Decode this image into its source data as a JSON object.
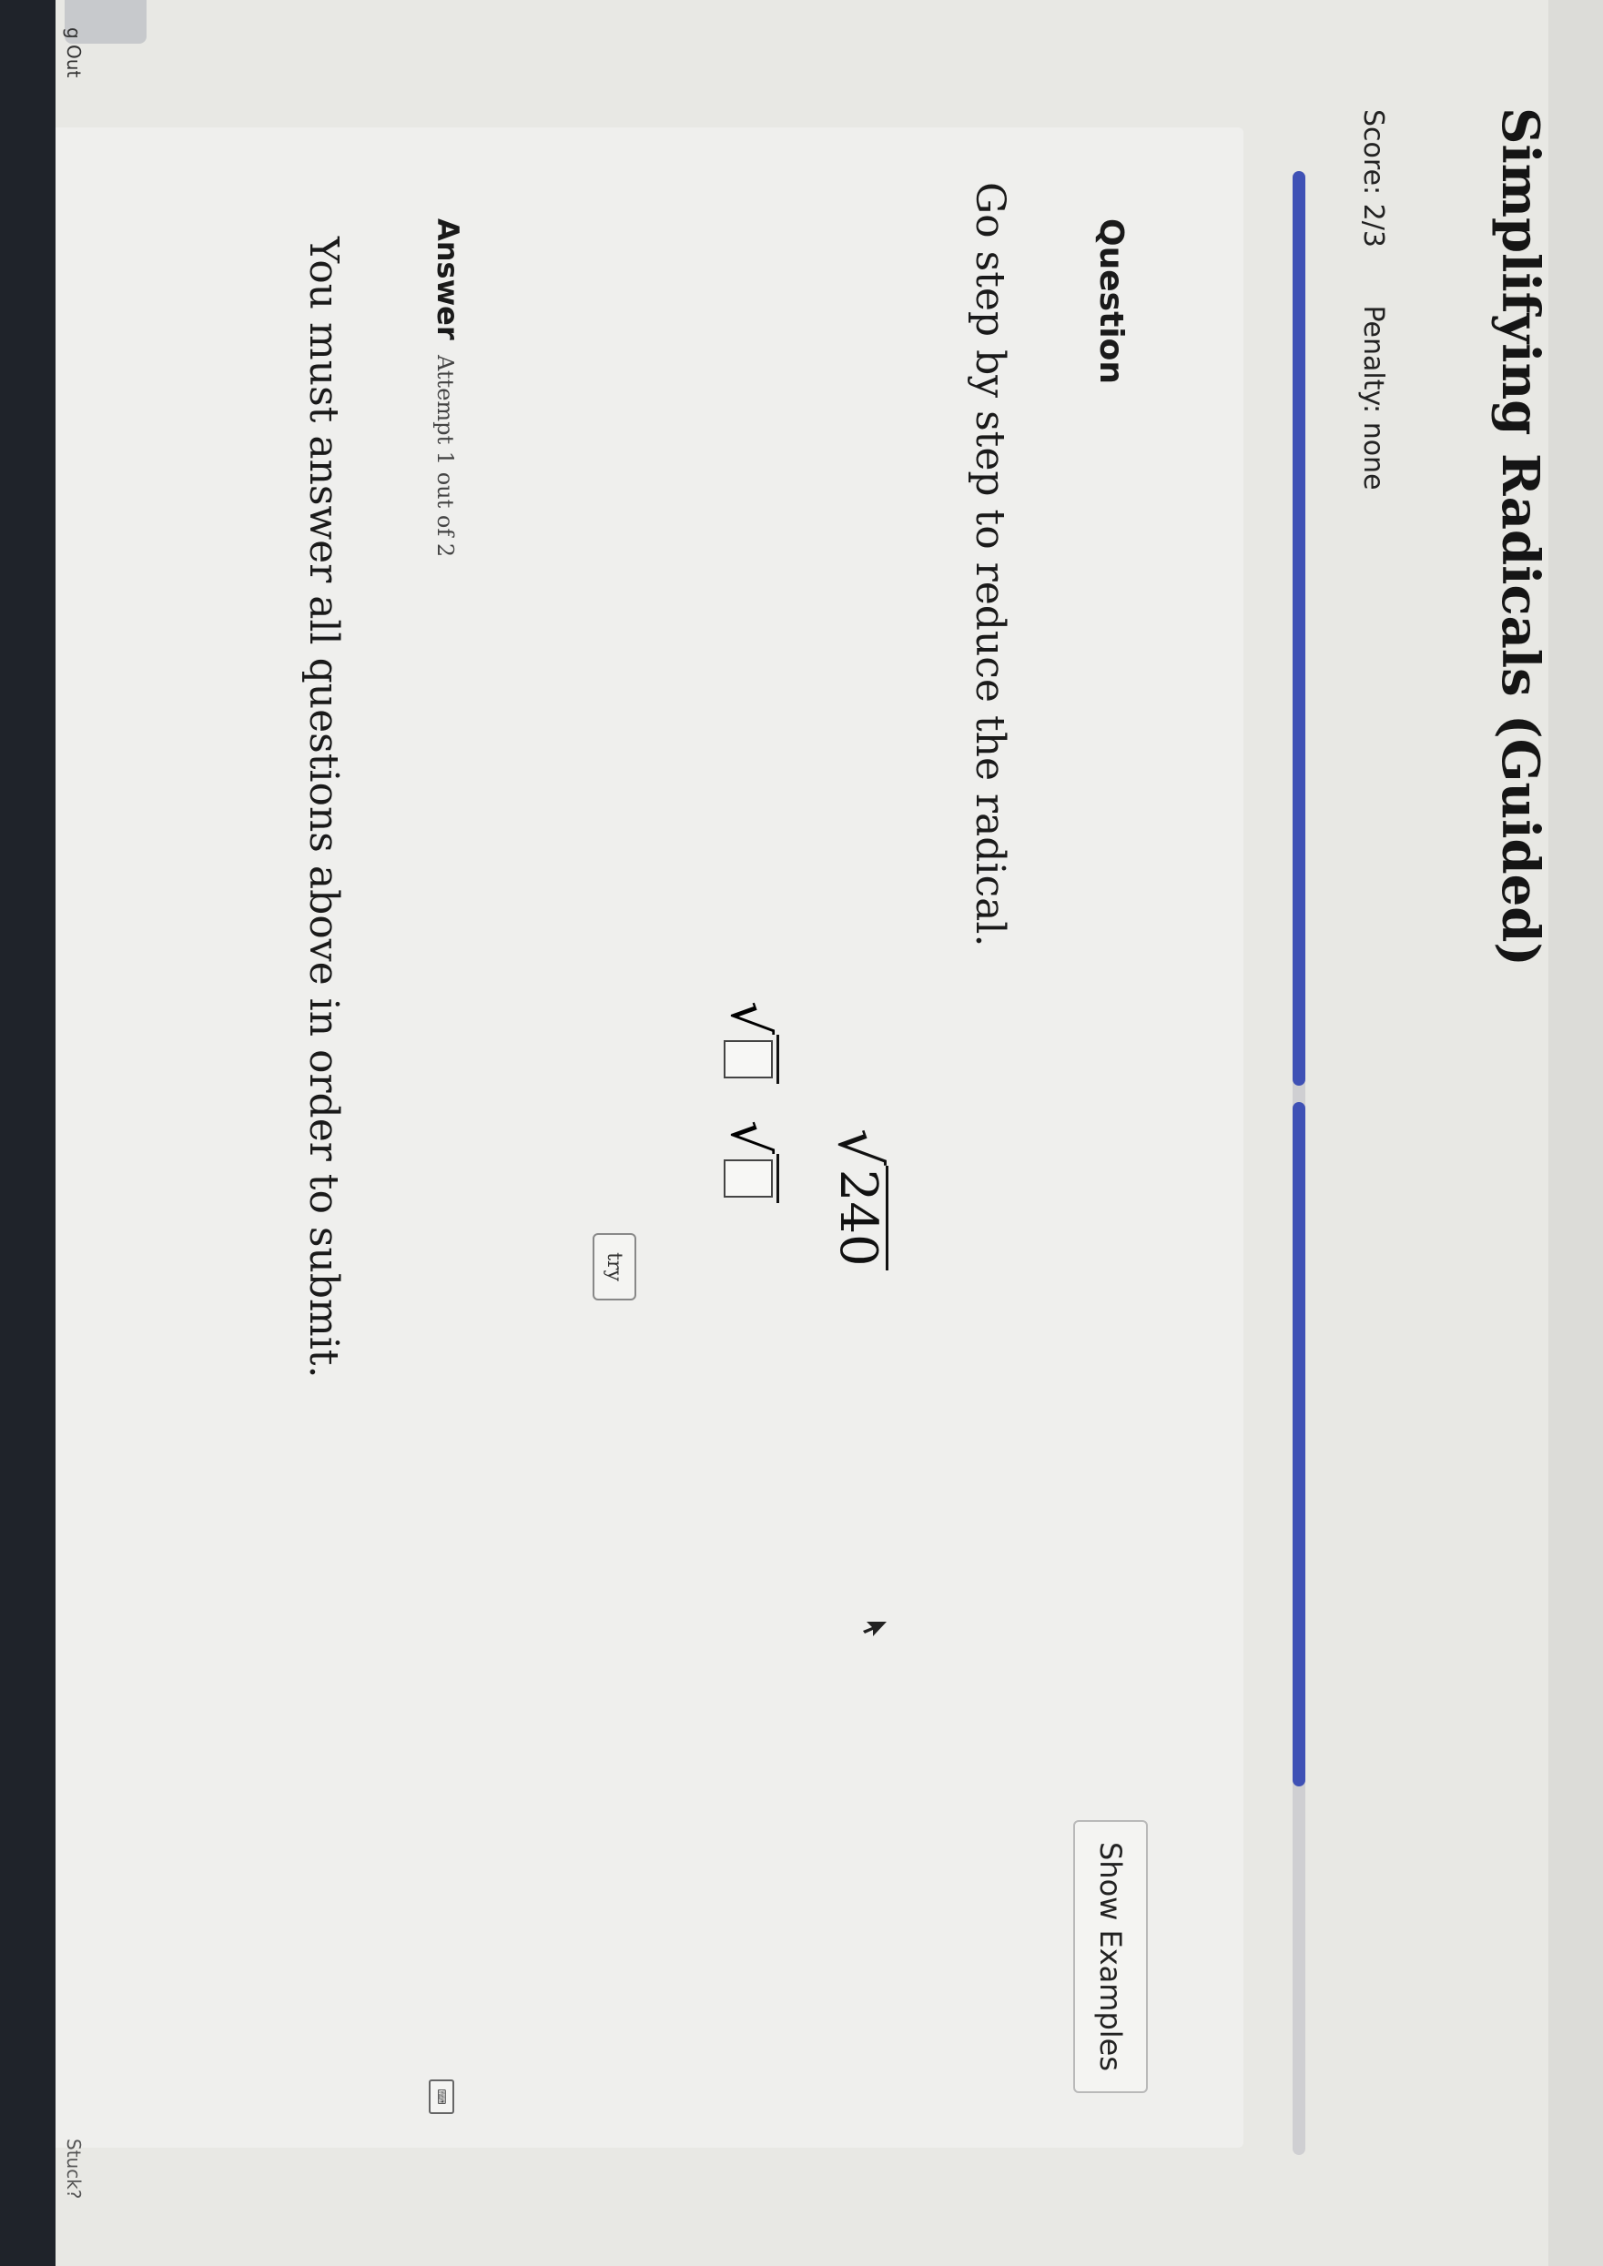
{
  "page": {
    "title": "Simplifying Radicals (Guided)",
    "score": "Score: 2/3",
    "penalty": "Penalty: none",
    "progress": {
      "total_segments": 3,
      "completed_segments": 2,
      "color": "#3f51b5"
    }
  },
  "question": {
    "label": "Question",
    "show_examples_label": "Show Examples",
    "prompt": "Go step by step to reduce the radical.",
    "radicand": "240",
    "try_label": "try"
  },
  "answer": {
    "label": "Answer",
    "attempt": "Attempt 1 out of 2",
    "submit_message": "You must answer all questions above in order to submit."
  },
  "footer": {
    "log_out": "g Out",
    "stuck": "Stuck?"
  },
  "icons": {
    "radical": "square-root-icon",
    "keyboard": "keyboard-icon",
    "cursor": "pointer-icon"
  }
}
